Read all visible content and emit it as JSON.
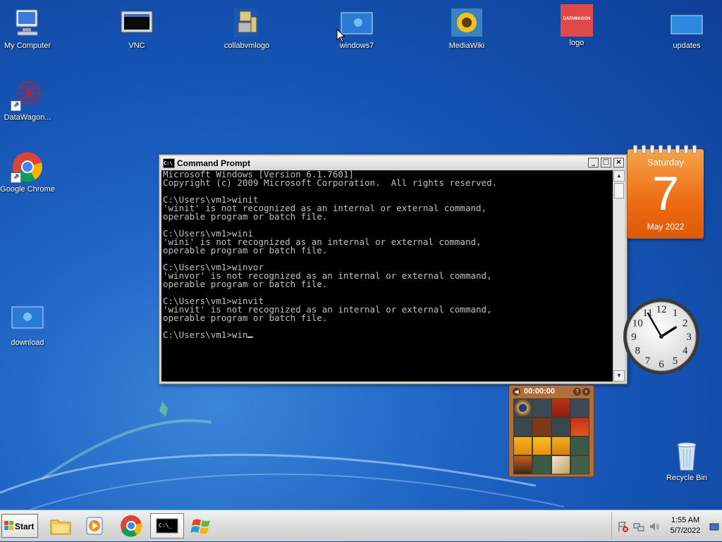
{
  "desktop": {
    "icons": [
      {
        "label": "My Computer"
      },
      {
        "label": "VNC"
      },
      {
        "label": "collabvmlogo"
      },
      {
        "label": "windows7"
      },
      {
        "label": "MediaWiki"
      },
      {
        "label": "logo"
      },
      {
        "label": "updates"
      },
      {
        "label": "DataWagon..."
      },
      {
        "label": "Google Chrome"
      },
      {
        "label": "download"
      },
      {
        "label": "Recycle Bin"
      }
    ],
    "logo_text": "DATAWAGON"
  },
  "cmd": {
    "title": "Command Prompt",
    "lines": [
      "Microsoft Windows [Version 6.1.7601]",
      "Copyright (c) 2009 Microsoft Corporation.  All rights reserved.",
      "",
      "C:\\Users\\vm1>winit",
      "'winit' is not recognized as an internal or external command,",
      "operable program or batch file.",
      "",
      "C:\\Users\\vm1>wini",
      "'wini' is not recognized as an internal or external command,",
      "operable program or batch file.",
      "",
      "C:\\Users\\vm1>winvor",
      "'winvor' is not recognized as an internal or external command,",
      "operable program or batch file.",
      "",
      "C:\\Users\\vm1>winvit",
      "'winvit' is not recognized as an internal or external command,",
      "operable program or batch file.",
      ""
    ],
    "prompt_line": "C:\\Users\\vm1>win",
    "minimize_glyph": "_",
    "maximize_glyph": "□",
    "close_glyph": "×",
    "app_icon_text": "C:\\"
  },
  "calendar": {
    "weekday": "Saturday",
    "day": "7",
    "month_year": "May 2022"
  },
  "clock": {
    "numbers": [
      "12",
      "1",
      "2",
      "3",
      "4",
      "5",
      "6",
      "7",
      "8",
      "9",
      "10",
      "11"
    ],
    "hour": 1,
    "minute": 55
  },
  "puzzle": {
    "timer": "00:00:00",
    "left_glyph": "◀",
    "help_glyph": "?",
    "close_glyph": "×"
  },
  "taskbar": {
    "start_label": "Start",
    "time": "1:55 AM",
    "date": "5/7/2022",
    "cmd_icon_text": "C:\\_"
  }
}
